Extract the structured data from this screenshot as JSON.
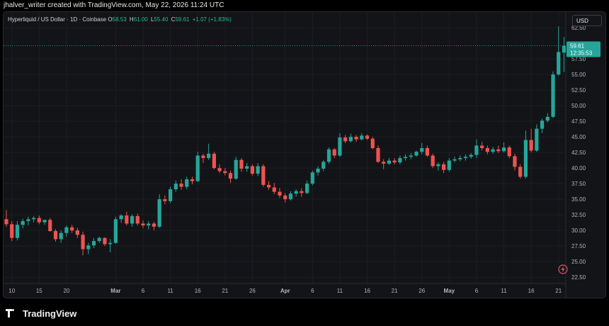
{
  "header": {
    "text": "jhalver_writer created with TradingView.com, May 22, 2026 11:24 UTC"
  },
  "legend": {
    "symbol": "Hyperliquid / US Dollar · 1D · Coinbase",
    "o_label": "O",
    "o_value": "58.53",
    "h_label": "H",
    "h_value": "61.00",
    "l_label": "L",
    "l_value": "55.40",
    "c_label": "C",
    "c_value": "59.61",
    "change": "+1.07 (+1.83%)"
  },
  "currency_button": "USD",
  "price_badge": {
    "price": "59.61",
    "countdown": "12:35:53"
  },
  "footer": {
    "brand": "TradingView",
    "logo_icon": "tradingview-logo-icon"
  },
  "colors": {
    "up": "#26a69a",
    "down": "#ef5350",
    "background": "#131417",
    "grid": "#1e2026"
  },
  "chart_data": {
    "type": "candlestick",
    "y_axis_ticks": [
      "22.50",
      "25.00",
      "27.50",
      "30.00",
      "32.50",
      "35.00",
      "37.50",
      "40.00",
      "42.50",
      "45.00",
      "47.50",
      "50.00",
      "52.50",
      "55.00",
      "57.50",
      "62.50"
    ],
    "ylim": [
      21.5,
      65
    ],
    "x_axis_ticks": [
      {
        "label": "10",
        "i": 1
      },
      {
        "label": "15",
        "i": 6
      },
      {
        "label": "20",
        "i": 11
      },
      {
        "label": "Mar",
        "i": 20,
        "bold": true
      },
      {
        "label": "6",
        "i": 25
      },
      {
        "label": "11",
        "i": 30
      },
      {
        "label": "16",
        "i": 35
      },
      {
        "label": "21",
        "i": 40
      },
      {
        "label": "26",
        "i": 45
      },
      {
        "label": "Apr",
        "i": 51,
        "bold": true
      },
      {
        "label": "6",
        "i": 56
      },
      {
        "label": "11",
        "i": 61
      },
      {
        "label": "16",
        "i": 66
      },
      {
        "label": "21",
        "i": 71
      },
      {
        "label": "26",
        "i": 76
      },
      {
        "label": "May",
        "i": 81,
        "bold": true
      },
      {
        "label": "6",
        "i": 86
      },
      {
        "label": "11",
        "i": 91
      },
      {
        "label": "16",
        "i": 96
      },
      {
        "label": "21",
        "i": 101
      }
    ],
    "candles": [
      {
        "o": 31.8,
        "h": 33.3,
        "l": 30.6,
        "c": 31.0
      },
      {
        "o": 31.0,
        "h": 31.5,
        "l": 28.3,
        "c": 28.8
      },
      {
        "o": 28.8,
        "h": 31.5,
        "l": 28.4,
        "c": 30.9
      },
      {
        "o": 30.9,
        "h": 31.9,
        "l": 30.3,
        "c": 31.5
      },
      {
        "o": 31.5,
        "h": 32.2,
        "l": 30.8,
        "c": 31.8
      },
      {
        "o": 31.8,
        "h": 32.3,
        "l": 31.3,
        "c": 32.0
      },
      {
        "o": 32.0,
        "h": 32.4,
        "l": 31.0,
        "c": 31.3
      },
      {
        "o": 31.3,
        "h": 31.7,
        "l": 30.9,
        "c": 31.7
      },
      {
        "o": 31.7,
        "h": 32.0,
        "l": 29.8,
        "c": 29.9
      },
      {
        "o": 29.9,
        "h": 30.2,
        "l": 28.2,
        "c": 28.6
      },
      {
        "o": 28.6,
        "h": 30.0,
        "l": 28.0,
        "c": 29.6
      },
      {
        "o": 29.6,
        "h": 30.8,
        "l": 29.0,
        "c": 30.5
      },
      {
        "o": 30.5,
        "h": 30.9,
        "l": 29.6,
        "c": 30.0
      },
      {
        "o": 30.0,
        "h": 30.4,
        "l": 28.8,
        "c": 29.3
      },
      {
        "o": 29.3,
        "h": 29.8,
        "l": 26.0,
        "c": 27.0
      },
      {
        "o": 27.0,
        "h": 28.0,
        "l": 26.2,
        "c": 27.6
      },
      {
        "o": 27.6,
        "h": 28.8,
        "l": 27.2,
        "c": 28.3
      },
      {
        "o": 28.3,
        "h": 29.0,
        "l": 28.0,
        "c": 28.8
      },
      {
        "o": 28.8,
        "h": 28.9,
        "l": 27.5,
        "c": 27.8
      },
      {
        "o": 27.8,
        "h": 28.6,
        "l": 26.5,
        "c": 28.0
      },
      {
        "o": 28.0,
        "h": 32.2,
        "l": 27.9,
        "c": 31.8
      },
      {
        "o": 31.8,
        "h": 32.6,
        "l": 31.2,
        "c": 32.4
      },
      {
        "o": 32.4,
        "h": 33.0,
        "l": 30.8,
        "c": 31.1
      },
      {
        "o": 31.1,
        "h": 32.6,
        "l": 30.6,
        "c": 32.3
      },
      {
        "o": 32.3,
        "h": 32.7,
        "l": 30.8,
        "c": 31.1
      },
      {
        "o": 31.1,
        "h": 31.6,
        "l": 30.4,
        "c": 30.8
      },
      {
        "o": 30.8,
        "h": 31.5,
        "l": 30.2,
        "c": 31.1
      },
      {
        "o": 31.1,
        "h": 31.4,
        "l": 30.0,
        "c": 30.6
      },
      {
        "o": 30.6,
        "h": 35.8,
        "l": 30.4,
        "c": 35.0
      },
      {
        "o": 35.0,
        "h": 35.6,
        "l": 34.2,
        "c": 34.7
      },
      {
        "o": 34.7,
        "h": 37.0,
        "l": 34.4,
        "c": 36.6
      },
      {
        "o": 36.6,
        "h": 38.0,
        "l": 36.2,
        "c": 37.5
      },
      {
        "o": 37.5,
        "h": 38.2,
        "l": 36.5,
        "c": 37.0
      },
      {
        "o": 37.0,
        "h": 38.6,
        "l": 36.6,
        "c": 38.2
      },
      {
        "o": 38.2,
        "h": 38.6,
        "l": 37.4,
        "c": 37.9
      },
      {
        "o": 37.9,
        "h": 42.6,
        "l": 37.8,
        "c": 42.0
      },
      {
        "o": 42.0,
        "h": 42.3,
        "l": 40.8,
        "c": 41.6
      },
      {
        "o": 41.6,
        "h": 43.9,
        "l": 41.3,
        "c": 42.3
      },
      {
        "o": 42.3,
        "h": 42.6,
        "l": 39.8,
        "c": 40.0
      },
      {
        "o": 40.0,
        "h": 40.6,
        "l": 39.2,
        "c": 39.5
      },
      {
        "o": 39.5,
        "h": 40.0,
        "l": 38.8,
        "c": 39.2
      },
      {
        "o": 39.2,
        "h": 39.6,
        "l": 37.6,
        "c": 38.3
      },
      {
        "o": 38.3,
        "h": 41.8,
        "l": 38.1,
        "c": 41.3
      },
      {
        "o": 41.3,
        "h": 41.6,
        "l": 39.4,
        "c": 39.9
      },
      {
        "o": 39.9,
        "h": 40.8,
        "l": 39.4,
        "c": 40.3
      },
      {
        "o": 40.3,
        "h": 40.6,
        "l": 38.8,
        "c": 39.1
      },
      {
        "o": 39.1,
        "h": 40.8,
        "l": 38.7,
        "c": 40.3
      },
      {
        "o": 40.3,
        "h": 40.6,
        "l": 37.0,
        "c": 37.3
      },
      {
        "o": 37.3,
        "h": 37.9,
        "l": 36.5,
        "c": 36.9
      },
      {
        "o": 36.9,
        "h": 37.6,
        "l": 35.8,
        "c": 36.2
      },
      {
        "o": 36.2,
        "h": 36.8,
        "l": 35.2,
        "c": 35.6
      },
      {
        "o": 35.6,
        "h": 36.0,
        "l": 34.5,
        "c": 35.0
      },
      {
        "o": 35.0,
        "h": 36.3,
        "l": 34.8,
        "c": 35.9
      },
      {
        "o": 35.9,
        "h": 36.6,
        "l": 35.4,
        "c": 36.3
      },
      {
        "o": 36.3,
        "h": 36.8,
        "l": 35.4,
        "c": 36.0
      },
      {
        "o": 36.0,
        "h": 38.0,
        "l": 35.8,
        "c": 37.5
      },
      {
        "o": 37.5,
        "h": 39.6,
        "l": 37.2,
        "c": 39.3
      },
      {
        "o": 39.3,
        "h": 40.3,
        "l": 38.8,
        "c": 39.9
      },
      {
        "o": 39.9,
        "h": 41.3,
        "l": 39.5,
        "c": 41.0
      },
      {
        "o": 41.0,
        "h": 43.3,
        "l": 40.7,
        "c": 43.0
      },
      {
        "o": 43.0,
        "h": 43.2,
        "l": 41.6,
        "c": 42.0
      },
      {
        "o": 42.0,
        "h": 45.6,
        "l": 41.8,
        "c": 44.9
      },
      {
        "o": 44.9,
        "h": 45.3,
        "l": 44.0,
        "c": 44.3
      },
      {
        "o": 44.3,
        "h": 45.5,
        "l": 44.1,
        "c": 45.0
      },
      {
        "o": 45.0,
        "h": 45.3,
        "l": 44.2,
        "c": 44.6
      },
      {
        "o": 44.6,
        "h": 45.6,
        "l": 44.4,
        "c": 45.2
      },
      {
        "o": 45.2,
        "h": 45.4,
        "l": 44.5,
        "c": 44.7
      },
      {
        "o": 44.7,
        "h": 45.0,
        "l": 43.0,
        "c": 43.2
      },
      {
        "o": 43.2,
        "h": 43.6,
        "l": 40.8,
        "c": 41.0
      },
      {
        "o": 41.0,
        "h": 41.4,
        "l": 39.8,
        "c": 40.7
      },
      {
        "o": 40.7,
        "h": 41.6,
        "l": 40.5,
        "c": 41.2
      },
      {
        "o": 41.2,
        "h": 41.6,
        "l": 40.6,
        "c": 40.9
      },
      {
        "o": 40.9,
        "h": 42.0,
        "l": 40.6,
        "c": 41.6
      },
      {
        "o": 41.6,
        "h": 42.2,
        "l": 41.2,
        "c": 41.8
      },
      {
        "o": 41.8,
        "h": 42.4,
        "l": 41.4,
        "c": 42.0
      },
      {
        "o": 42.0,
        "h": 42.8,
        "l": 41.8,
        "c": 42.6
      },
      {
        "o": 42.6,
        "h": 44.0,
        "l": 42.2,
        "c": 43.2
      },
      {
        "o": 43.2,
        "h": 43.6,
        "l": 41.8,
        "c": 42.0
      },
      {
        "o": 42.0,
        "h": 42.3,
        "l": 40.0,
        "c": 40.3
      },
      {
        "o": 40.3,
        "h": 40.9,
        "l": 39.6,
        "c": 40.6
      },
      {
        "o": 40.6,
        "h": 41.0,
        "l": 39.2,
        "c": 39.7
      },
      {
        "o": 39.7,
        "h": 41.6,
        "l": 39.4,
        "c": 41.2
      },
      {
        "o": 41.2,
        "h": 41.8,
        "l": 40.9,
        "c": 41.4
      },
      {
        "o": 41.4,
        "h": 42.0,
        "l": 41.1,
        "c": 41.6
      },
      {
        "o": 41.6,
        "h": 42.2,
        "l": 41.2,
        "c": 41.8
      },
      {
        "o": 41.8,
        "h": 42.4,
        "l": 41.5,
        "c": 42.1
      },
      {
        "o": 42.1,
        "h": 44.6,
        "l": 41.6,
        "c": 43.6
      },
      {
        "o": 43.6,
        "h": 44.2,
        "l": 42.8,
        "c": 43.2
      },
      {
        "o": 43.2,
        "h": 43.6,
        "l": 42.2,
        "c": 42.6
      },
      {
        "o": 42.6,
        "h": 43.4,
        "l": 42.3,
        "c": 43.0
      },
      {
        "o": 43.0,
        "h": 43.6,
        "l": 42.4,
        "c": 42.7
      },
      {
        "o": 42.7,
        "h": 44.1,
        "l": 42.5,
        "c": 43.3
      },
      {
        "o": 43.3,
        "h": 43.6,
        "l": 41.6,
        "c": 41.9
      },
      {
        "o": 41.9,
        "h": 42.3,
        "l": 39.6,
        "c": 40.2
      },
      {
        "o": 40.2,
        "h": 40.6,
        "l": 38.3,
        "c": 38.6
      },
      {
        "o": 38.6,
        "h": 46.0,
        "l": 38.3,
        "c": 44.5
      },
      {
        "o": 44.5,
        "h": 46.3,
        "l": 42.5,
        "c": 42.8
      },
      {
        "o": 42.8,
        "h": 47.0,
        "l": 42.6,
        "c": 46.3
      },
      {
        "o": 46.3,
        "h": 47.9,
        "l": 45.6,
        "c": 47.6
      },
      {
        "o": 47.6,
        "h": 48.8,
        "l": 47.3,
        "c": 48.2
      },
      {
        "o": 48.2,
        "h": 55.5,
        "l": 48.0,
        "c": 55.0
      },
      {
        "o": 55.0,
        "h": 62.7,
        "l": 54.8,
        "c": 58.6
      },
      {
        "o": 58.5,
        "h": 61.0,
        "l": 55.4,
        "c": 59.6
      }
    ]
  }
}
